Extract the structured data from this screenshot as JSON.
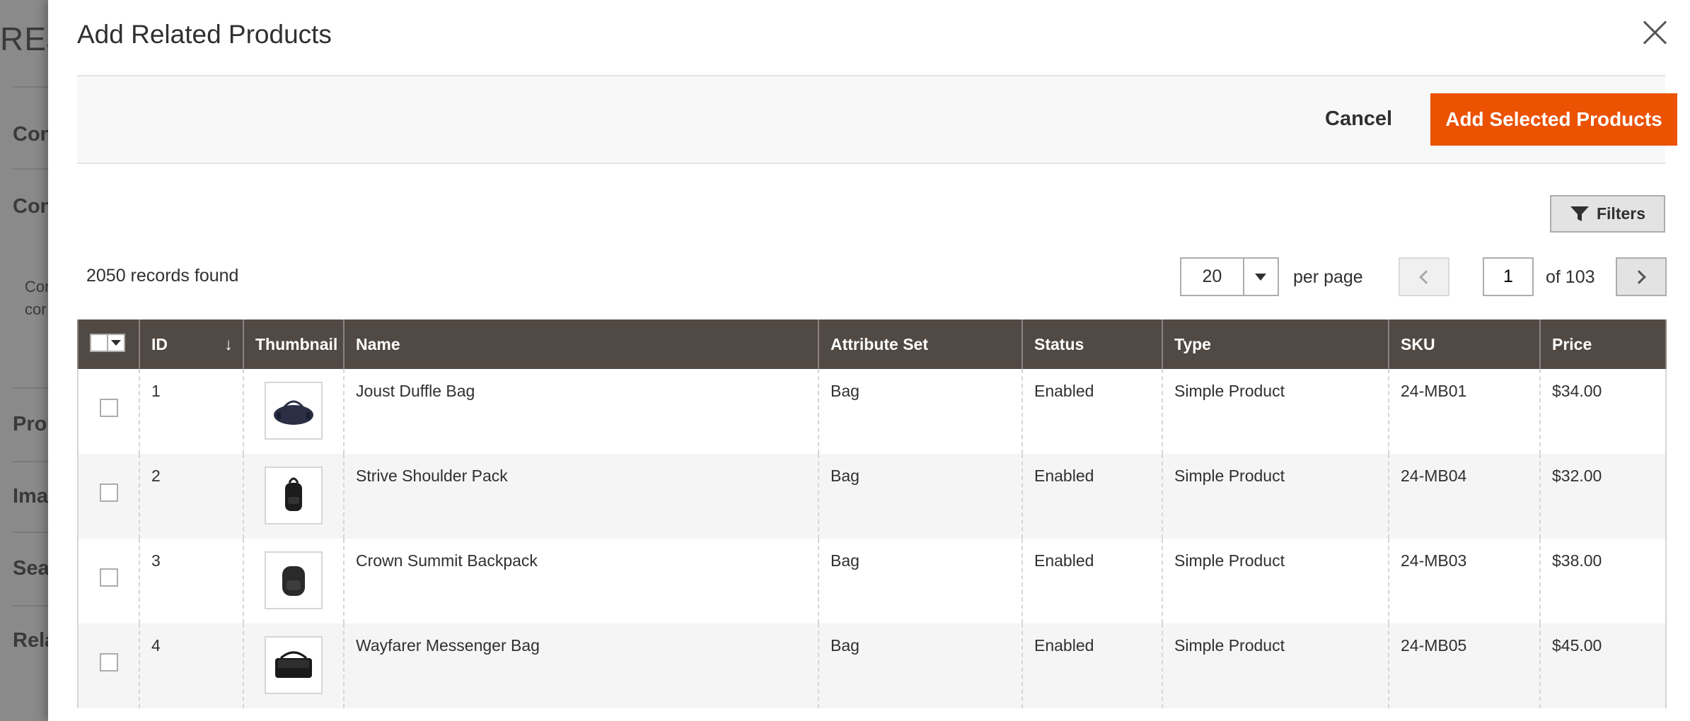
{
  "background": {
    "brand": "REJ",
    "items": [
      "Con",
      "Con",
      "Pro",
      "Ima",
      "Sea",
      "Rela"
    ],
    "subtext": [
      "Cor",
      "cor"
    ]
  },
  "modal": {
    "title": "Add Related Products",
    "cancel_label": "Cancel",
    "add_label": "Add Selected Products",
    "filters_label": "Filters"
  },
  "toolbar": {
    "records_found": "2050 records found",
    "per_page_value": "20",
    "per_page_label": "per page",
    "current_page": "1",
    "page_of": "of 103"
  },
  "grid": {
    "columns": {
      "id": "ID",
      "thumbnail": "Thumbnail",
      "name": "Name",
      "attribute_set": "Attribute Set",
      "status": "Status",
      "type": "Type",
      "sku": "SKU",
      "price": "Price"
    },
    "sort_indicator": "↓",
    "rows": [
      {
        "id": "1",
        "name": "Joust Duffle Bag",
        "attribute_set": "Bag",
        "status": "Enabled",
        "type": "Simple Product",
        "sku": "24-MB01",
        "price": "$34.00",
        "thumb_icon": "duffle-bag-icon"
      },
      {
        "id": "2",
        "name": "Strive Shoulder Pack",
        "attribute_set": "Bag",
        "status": "Enabled",
        "type": "Simple Product",
        "sku": "24-MB04",
        "price": "$32.00",
        "thumb_icon": "shoulder-pack-icon"
      },
      {
        "id": "3",
        "name": "Crown Summit Backpack",
        "attribute_set": "Bag",
        "status": "Enabled",
        "type": "Simple Product",
        "sku": "24-MB03",
        "price": "$38.00",
        "thumb_icon": "backpack-icon"
      },
      {
        "id": "4",
        "name": "Wayfarer Messenger Bag",
        "attribute_set": "Bag",
        "status": "Enabled",
        "type": "Simple Product",
        "sku": "24-MB05",
        "price": "$45.00",
        "thumb_icon": "messenger-bag-icon"
      }
    ]
  },
  "colors": {
    "accent": "#eb5202",
    "header_bg": "#514943"
  }
}
